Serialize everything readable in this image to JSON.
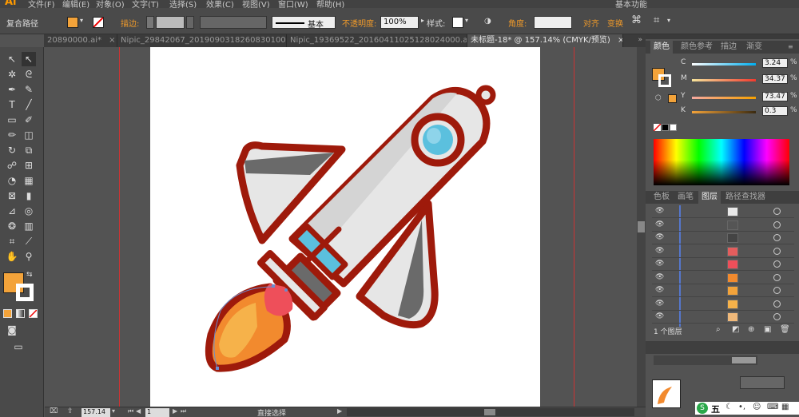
{
  "app": {
    "logo": "Ai",
    "menu": [
      "文件(F)",
      "编辑(E)",
      "对象(O)",
      "文字(T)",
      "选择(S)",
      "效果(C)",
      "视图(V)",
      "窗口(W)",
      "帮助(H)"
    ],
    "workspace": "基本功能"
  },
  "control_bar": {
    "selection_label": "复合路径",
    "fill_color": "#F3A33A",
    "stroke_label": "描边:",
    "stroke_style": "基本",
    "opacity_label": "不透明度:",
    "opacity_value": "100%",
    "style_label": "样式:",
    "angle_label": "角度:",
    "align_label": "对齐",
    "transform_label": "变换"
  },
  "tabs": [
    {
      "label": "20890000.ai*",
      "active": false
    },
    {
      "label": "Nipic_29842067_20190903182608301000.ai*",
      "active": false
    },
    {
      "label": "Nipic_19369522_20160411025128024000.ai*",
      "active": false
    },
    {
      "label": "未标题-18* @ 157.14% (CMYK/预览)",
      "active": true
    }
  ],
  "tab_close": "×",
  "color_panel": {
    "tabs": [
      "颜色",
      "颜色参考",
      "描边",
      "渐变"
    ],
    "active_tab": "颜色",
    "fill_color": "#F3A33A",
    "channels": [
      {
        "name": "C",
        "value": "3.24",
        "colors": [
          "#ffffff",
          "#00aeef"
        ]
      },
      {
        "name": "M",
        "value": "34.37",
        "colors": [
          "#f5e39a",
          "#f03a2e"
        ]
      },
      {
        "name": "Y",
        "value": "73.47",
        "colors": [
          "#f6a9a0",
          "#f5a000"
        ]
      },
      {
        "name": "K",
        "value": "0.3",
        "colors": [
          "#f3a33a",
          "#3a2a10"
        ]
      }
    ],
    "percent": "%"
  },
  "layers_panel": {
    "tabs": [
      "色板",
      "画笔",
      "图层",
      "路径查找器"
    ],
    "active_tab": "图层",
    "rows": [
      {
        "thumb": "#e8e8e8"
      },
      {
        "thumb": "#555555"
      },
      {
        "thumb": "#444444"
      },
      {
        "thumb": "#e35d5d"
      },
      {
        "thumb": "#ee4f5a"
      },
      {
        "thumb": "#f28a2e"
      },
      {
        "thumb": "#f3a33a"
      },
      {
        "thumb": "#f6b24a"
      },
      {
        "thumb": "#f0b97a"
      }
    ],
    "footer": "1 个图层"
  },
  "status_bar": {
    "zoom": "157.14",
    "page": "1",
    "tool": "直接选择"
  },
  "ime_bar": {
    "label": "五"
  },
  "artwork": {
    "outline_color": "#9E1A0B",
    "body_color": "#E6E6E6",
    "wing_color": "#6A6A6A",
    "window_color": "#5BC0DE",
    "flame_orange": "#F28A2E",
    "flame_red": "#EE4F5A",
    "flame_light": "#F6B24A"
  }
}
